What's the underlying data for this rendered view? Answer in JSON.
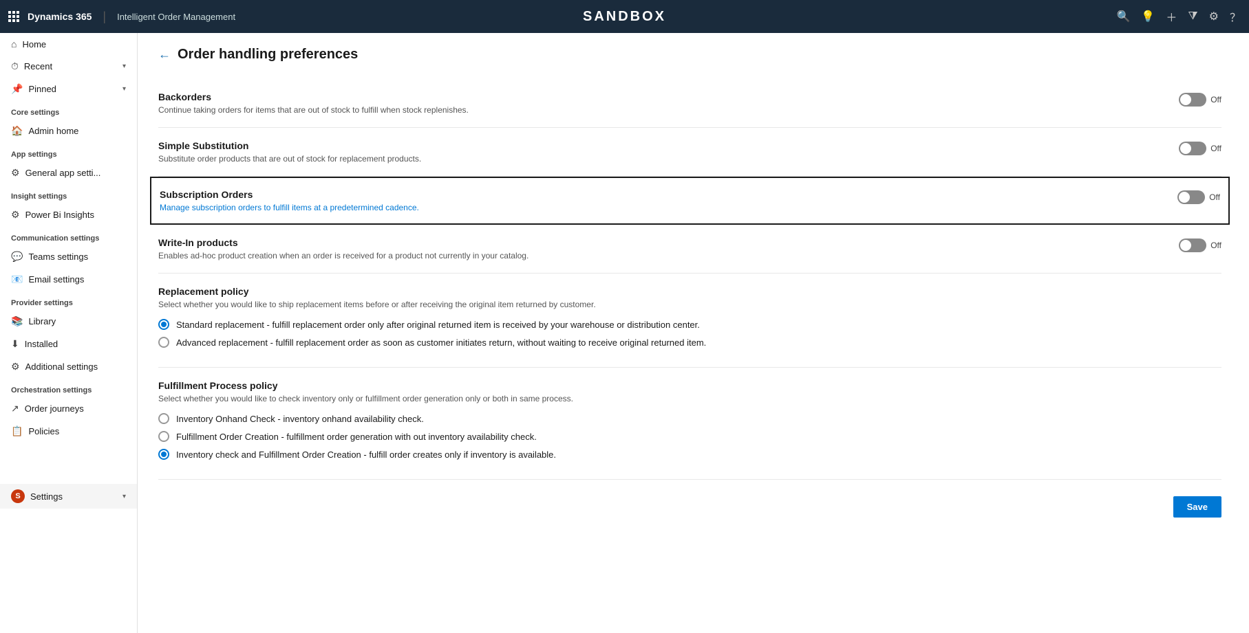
{
  "topnav": {
    "brand": "Dynamics 365",
    "separator": "|",
    "app_name": "Intelligent Order Management",
    "sandbox_title": "SANDBOX",
    "icons": [
      "search",
      "lightbulb",
      "plus",
      "filter",
      "settings",
      "help"
    ]
  },
  "sidebar": {
    "menu_icon": "☰",
    "nav_items": [
      {
        "label": "Home",
        "icon": "⌂",
        "section": null
      },
      {
        "label": "Recent",
        "icon": "⏱",
        "has_chevron": true
      },
      {
        "label": "Pinned",
        "icon": "📌",
        "has_chevron": true
      }
    ],
    "sections": [
      {
        "title": "Core settings",
        "items": [
          {
            "label": "Admin home",
            "icon": "🏠"
          }
        ]
      },
      {
        "title": "App settings",
        "items": [
          {
            "label": "General app setti...",
            "icon": "⚙"
          }
        ]
      },
      {
        "title": "Insight settings",
        "items": [
          {
            "label": "Power Bi Insights",
            "icon": "⚙"
          }
        ]
      },
      {
        "title": "Communication settings",
        "items": [
          {
            "label": "Teams settings",
            "icon": "💬"
          },
          {
            "label": "Email settings",
            "icon": "📧"
          }
        ]
      },
      {
        "title": "Provider settings",
        "items": [
          {
            "label": "Library",
            "icon": "📚"
          },
          {
            "label": "Installed",
            "icon": "⬇"
          },
          {
            "label": "Additional settings",
            "icon": "⚙"
          }
        ]
      },
      {
        "title": "Orchestration settings",
        "items": [
          {
            "label": "Order journeys",
            "icon": "↗"
          },
          {
            "label": "Policies",
            "icon": "📋"
          }
        ]
      }
    ],
    "bottom_item": {
      "label": "Settings",
      "avatar": "S"
    }
  },
  "content": {
    "back_arrow": "←",
    "page_title": "Order handling preferences",
    "settings": [
      {
        "id": "backorders",
        "title": "Backorders",
        "description": "Continue taking orders for items that are out of stock to fulfill when stock replenishes.",
        "toggle_state": "Off",
        "highlighted": false
      },
      {
        "id": "simple-substitution",
        "title": "Simple Substitution",
        "description": "Substitute order products that are out of stock for replacement products.",
        "toggle_state": "Off",
        "highlighted": false
      },
      {
        "id": "subscription-orders",
        "title": "Subscription Orders",
        "description": "Manage subscription orders to fulfill items at a predetermined cadence.",
        "toggle_state": "Off",
        "highlighted": true
      },
      {
        "id": "write-in-products",
        "title": "Write-In products",
        "description": "Enables ad-hoc product creation when an order is received for a product not currently in your catalog.",
        "toggle_state": "Off",
        "highlighted": false
      }
    ],
    "replacement_policy": {
      "title": "Replacement policy",
      "description": "Select whether you would like to ship replacement items before or after receiving the original item returned by customer.",
      "options": [
        {
          "id": "standard",
          "label": "Standard replacement - fulfill replacement order only after original returned item is received by your warehouse or distribution center.",
          "selected": true
        },
        {
          "id": "advanced",
          "label": "Advanced replacement - fulfill replacement order as soon as customer initiates return, without waiting to receive original returned item.",
          "selected": false
        }
      ]
    },
    "fulfillment_policy": {
      "title": "Fulfillment Process policy",
      "description": "Select whether you would like to check inventory only or fulfillment order generation only or both in same process.",
      "options": [
        {
          "id": "inventory-onhand",
          "label": "Inventory Onhand Check - inventory onhand availability check.",
          "selected": false
        },
        {
          "id": "fulfillment-order-creation",
          "label": "Fulfillment Order Creation - fulfillment order generation with out inventory availability check.",
          "selected": false
        },
        {
          "id": "inventory-and-fulfillment",
          "label": "Inventory check and Fulfillment Order Creation - fulfill order creates only if inventory is available.",
          "selected": true
        }
      ]
    },
    "save_button": "Save"
  }
}
